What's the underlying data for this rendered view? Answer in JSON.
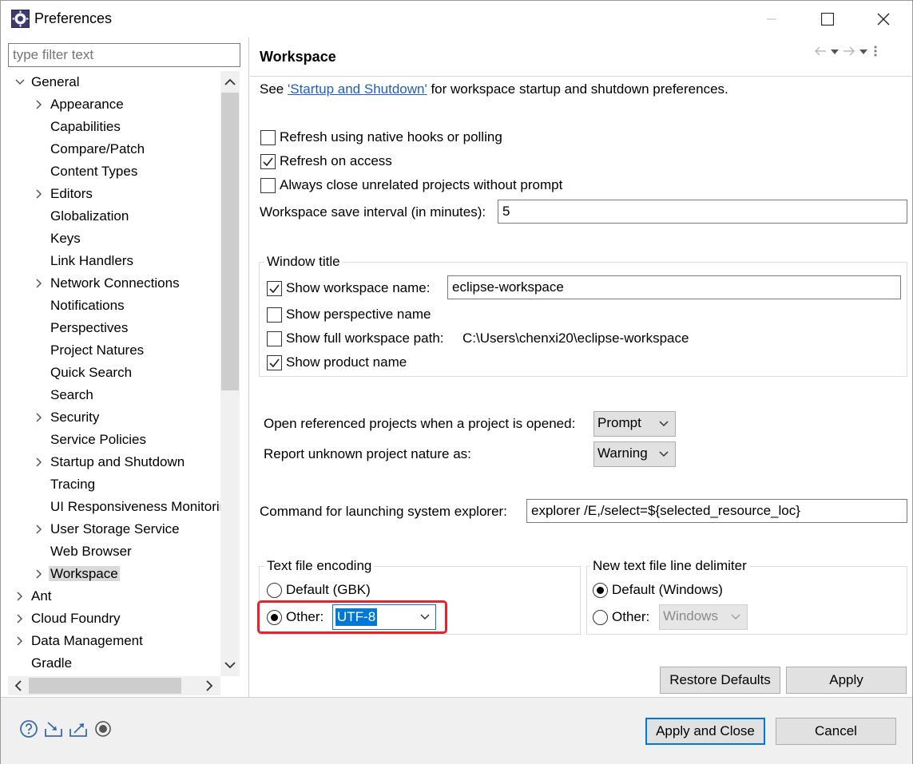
{
  "window": {
    "title": "Preferences"
  },
  "filter": {
    "placeholder": "type filter text"
  },
  "tree": [
    {
      "label": "General",
      "level": 0,
      "expanded": true
    },
    {
      "label": "Appearance",
      "level": 1,
      "expandable": true
    },
    {
      "label": "Capabilities",
      "level": 1
    },
    {
      "label": "Compare/Patch",
      "level": 1
    },
    {
      "label": "Content Types",
      "level": 1
    },
    {
      "label": "Editors",
      "level": 1,
      "expandable": true
    },
    {
      "label": "Globalization",
      "level": 1
    },
    {
      "label": "Keys",
      "level": 1
    },
    {
      "label": "Link Handlers",
      "level": 1
    },
    {
      "label": "Network Connections",
      "level": 1,
      "expandable": true
    },
    {
      "label": "Notifications",
      "level": 1
    },
    {
      "label": "Perspectives",
      "level": 1
    },
    {
      "label": "Project Natures",
      "level": 1
    },
    {
      "label": "Quick Search",
      "level": 1
    },
    {
      "label": "Search",
      "level": 1
    },
    {
      "label": "Security",
      "level": 1,
      "expandable": true
    },
    {
      "label": "Service Policies",
      "level": 1
    },
    {
      "label": "Startup and Shutdown",
      "level": 1,
      "expandable": true
    },
    {
      "label": "Tracing",
      "level": 1
    },
    {
      "label": "UI Responsiveness Monitoring",
      "level": 1
    },
    {
      "label": "User Storage Service",
      "level": 1,
      "expandable": true
    },
    {
      "label": "Web Browser",
      "level": 1
    },
    {
      "label": "Workspace",
      "level": 1,
      "expandable": true,
      "selected": true
    },
    {
      "label": "Ant",
      "level": 0,
      "expandable": true
    },
    {
      "label": "Cloud Foundry",
      "level": 0,
      "expandable": true
    },
    {
      "label": "Data Management",
      "level": 0,
      "expandable": true
    },
    {
      "label": "Gradle",
      "level": 0
    }
  ],
  "page": {
    "title": "Workspace",
    "see_prefix": "See ",
    "see_link": "'Startup and Shutdown'",
    "see_suffix": " for workspace startup and shutdown preferences.",
    "refresh_native": {
      "label": "Refresh using native hooks or polling",
      "checked": false
    },
    "refresh_access": {
      "label": "Refresh on access",
      "checked": true
    },
    "always_close": {
      "label": "Always close unrelated projects without prompt",
      "checked": false
    },
    "save_interval_label": "Workspace save interval (in minutes):",
    "save_interval_value": "5",
    "window_title_group": "Window title",
    "show_ws_name": {
      "label": "Show workspace name:",
      "checked": true,
      "value": "eclipse-workspace"
    },
    "show_perspective": {
      "label": "Show perspective name",
      "checked": false
    },
    "show_full_path": {
      "label": "Show full workspace path:",
      "checked": false,
      "value": "C:\\Users\\chenxi20\\eclipse-workspace"
    },
    "show_product": {
      "label": "Show product name",
      "checked": true
    },
    "open_ref_label": "Open referenced projects when a project is opened:",
    "open_ref_value": "Prompt",
    "unknown_nature_label": "Report unknown project nature as:",
    "unknown_nature_value": "Warning",
    "explorer_label": "Command for launching system explorer:",
    "explorer_value": "explorer /E,/select=${selected_resource_loc}",
    "encoding_group": "Text file encoding",
    "encoding_default": "Default (GBK)",
    "encoding_other": "Other:",
    "encoding_value": "UTF-8",
    "delim_group": "New text file line delimiter",
    "delim_default": "Default (Windows)",
    "delim_other": "Other:",
    "delim_value": "Windows"
  },
  "buttons": {
    "restore": "Restore Defaults",
    "apply": "Apply",
    "apply_close": "Apply and Close",
    "cancel": "Cancel"
  },
  "colors": {
    "accent": "#0078d7",
    "highlight_box": "#e8222a",
    "link": "#1f5fbf"
  }
}
